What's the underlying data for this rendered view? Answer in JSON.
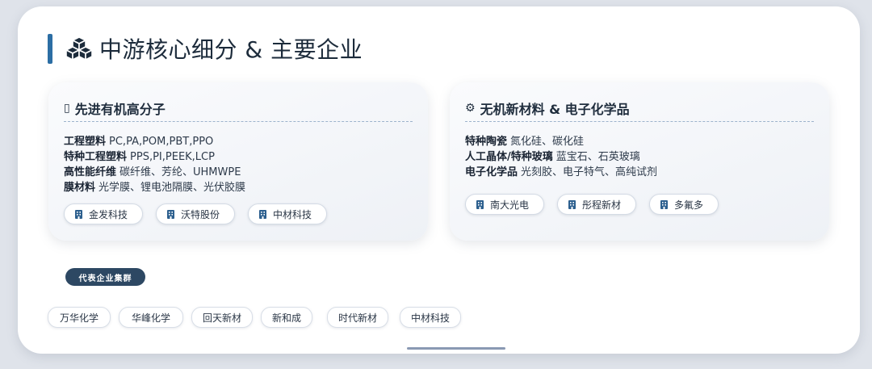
{
  "header": {
    "title": "中游核心细分 & 主要企业",
    "icon": "cubes-icon",
    "accent_color": "#2c6ea4"
  },
  "panels": [
    {
      "title": "先进有机高分子",
      "icon_glyph": "▯",
      "lines": [
        {
          "term": "工程塑料",
          "desc": "PC,PA,POM,PBT,PPO"
        },
        {
          "term": "特种工程塑料",
          "desc": "PPS,PI,PEEK,LCP"
        },
        {
          "term": "高性能纤维",
          "desc": "碳纤维、芳纶、UHMWPE"
        },
        {
          "term": "膜材料",
          "desc": "光学膜、锂电池隔膜、光伏胶膜"
        }
      ],
      "companies": [
        "金发科技",
        "沃特股份",
        "中材科技"
      ]
    },
    {
      "title": "无机新材料 & 电子化学品",
      "icon_glyph": "⚙",
      "lines": [
        {
          "term": "特种陶瓷",
          "desc": "氮化硅、碳化硅"
        },
        {
          "term": "人工晶体/特种玻璃",
          "desc": "蓝宝石、石英玻璃"
        },
        {
          "term": "电子化学品",
          "desc": "光刻胶、电子特气、高纯试剂"
        }
      ],
      "companies": [
        "南大光电",
        "彤程新材",
        "多氟多"
      ]
    }
  ],
  "cluster": {
    "label": "代表企业集群",
    "companies": [
      "万华化学",
      "华峰化学",
      "回天新材",
      "新和成",
      "时代新材",
      "中材科技"
    ]
  },
  "colors": {
    "badge_bg": "#2d4863",
    "chip_icon": "#2c5f8e"
  }
}
